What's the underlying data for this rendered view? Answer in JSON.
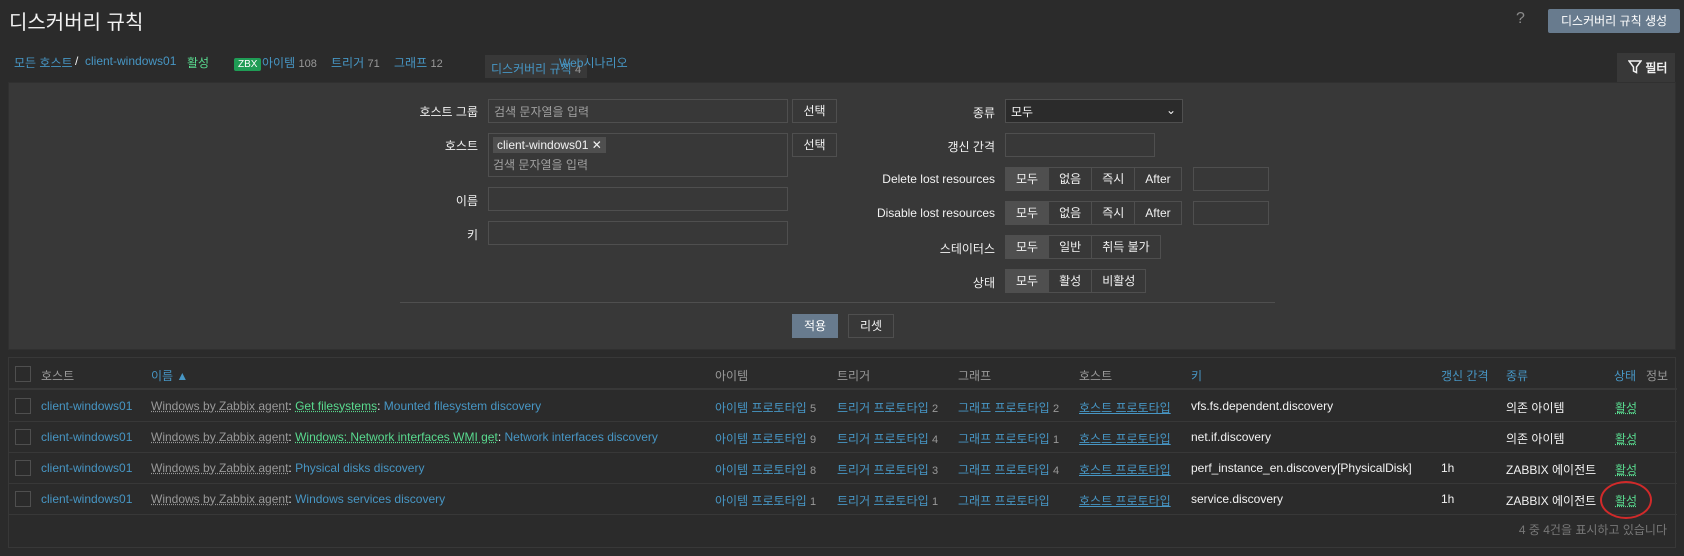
{
  "header": {
    "title": "디스커버리 규칙",
    "help": "?",
    "create_button": "디스커버리 규칙 생성"
  },
  "breadcrumbs": {
    "all_hosts": "모든 호스트",
    "sep": "/",
    "host": "client-windows01",
    "status": "활성",
    "zbx": "ZBX",
    "items": "아이템",
    "items_count": "108",
    "triggers": "트리거",
    "triggers_count": "71",
    "graphs": "그래프",
    "graphs_count": "12",
    "discovery": "디스커버리 규칙",
    "discovery_count": "4",
    "web": "Web시나리오"
  },
  "filter": {
    "tab_label": "필터",
    "host_group_label": "호스트 그룹",
    "host_group_placeholder": "검색 문자열을 입력",
    "select_label": "선택",
    "host_label": "호스트",
    "host_tag": "client-windows01",
    "host_placeholder": "검색 문자열을 입력",
    "name_label": "이름",
    "key_label": "키",
    "type_label": "종류",
    "type_value": "모두",
    "interval_label": "갱신 간격",
    "delete_lost_label": "Delete lost resources",
    "disable_lost_label": "Disable lost resources",
    "lost_options": [
      "모두",
      "없음",
      "즉시",
      "After"
    ],
    "state_label": "스테이터스",
    "state_options": [
      "모두",
      "일반",
      "취득 불가"
    ],
    "status_label": "상태",
    "status_options": [
      "모두",
      "활성",
      "비활성"
    ],
    "apply": "적용",
    "reset": "리셋"
  },
  "table": {
    "columns": {
      "host": "호스트",
      "name": "이름 ▲",
      "items": "아이템",
      "triggers": "트리거",
      "graphs": "그래프",
      "hosts": "호스트",
      "key": "키",
      "interval": "갱신 간격",
      "type": "종류",
      "status": "상태",
      "info": "정보"
    },
    "rows": [
      {
        "host": "client-windows01",
        "template": "Windows by Zabbix agent",
        "parent": "Get filesystems",
        "name": "Mounted filesystem discovery",
        "items_label": "아이템 프로토타입",
        "items_count": "5",
        "triggers_label": "트리거 프로토타입",
        "triggers_count": "2",
        "graphs_label": "그래프 프로토타입",
        "graphs_count": "2",
        "hosts_label": "호스트 프로토타입",
        "key": "vfs.fs.dependent.discovery",
        "interval": "",
        "type": "의존 아이템",
        "status": "활성"
      },
      {
        "host": "client-windows01",
        "template": "Windows by Zabbix agent",
        "parent": "Windows: Network interfaces WMI get",
        "name": "Network interfaces discovery",
        "items_label": "아이템 프로토타입",
        "items_count": "9",
        "triggers_label": "트리거 프로토타입",
        "triggers_count": "4",
        "graphs_label": "그래프 프로토타입",
        "graphs_count": "1",
        "hosts_label": "호스트 프로토타입",
        "key": "net.if.discovery",
        "interval": "",
        "type": "의존 아이템",
        "status": "활성"
      },
      {
        "host": "client-windows01",
        "template": "Windows by Zabbix agent",
        "parent": "",
        "name": "Physical disks discovery",
        "items_label": "아이템 프로토타입",
        "items_count": "8",
        "triggers_label": "트리거 프로토타입",
        "triggers_count": "3",
        "graphs_label": "그래프 프로토타입",
        "graphs_count": "4",
        "hosts_label": "호스트 프로토타입",
        "key": "perf_instance_en.discovery[PhysicalDisk]",
        "interval": "1h",
        "type": "ZABBIX 에이전트",
        "status": "활성"
      },
      {
        "host": "client-windows01",
        "template": "Windows by Zabbix agent",
        "parent": "",
        "name": "Windows services discovery",
        "items_label": "아이템 프로토타입",
        "items_count": "1",
        "triggers_label": "트리거 프로토타입",
        "triggers_count": "1",
        "graphs_label": "그래프 프로토타입",
        "graphs_count": "",
        "hosts_label": "호스트 프로토타입",
        "key": "service.discovery",
        "interval": "1h",
        "type": "ZABBIX 에이전트",
        "status": "활성"
      }
    ],
    "footer": "4 중 4건을 표시하고 있습니다"
  }
}
